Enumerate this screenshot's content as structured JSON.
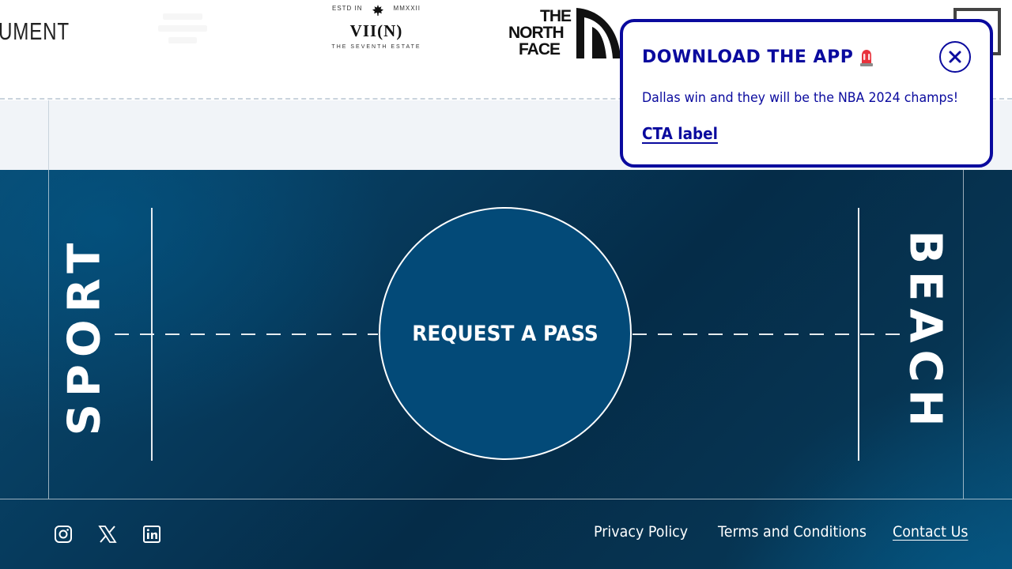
{
  "sponsors": {
    "umbro_text": "UMENT",
    "viin": {
      "left": "ESTD IN",
      "right": "MMXXII",
      "main": "VII(N)",
      "sub": "THE SEVENTH ESTATE"
    },
    "tnf": {
      "line1": "THE",
      "line2": "NORTH",
      "line3": "FACE"
    }
  },
  "court": {
    "left_word": "SPORT",
    "right_word": "BEACH",
    "request_pass_label": "REQUEST A PASS"
  },
  "footer": {
    "social": [
      "instagram-icon",
      "x-icon",
      "linkedin-icon"
    ],
    "links": {
      "privacy": "Privacy Policy",
      "terms": "Terms and Conditions",
      "contact": "Contact Us"
    }
  },
  "popup": {
    "title": "DOWNLOAD THE APP",
    "message": "Dallas win and they will be the NBA 2024 champs!",
    "cta_label": "CTA label",
    "icons": {
      "title_icon": "alarm-light-icon",
      "close_icon": "close-icon"
    }
  },
  "colors": {
    "popup_accent": "#0a0a9e",
    "court_dark": "#052c48",
    "court_light": "#0a4d73",
    "pass_circle": "#034a78",
    "light_band": "#f1f4f8"
  }
}
